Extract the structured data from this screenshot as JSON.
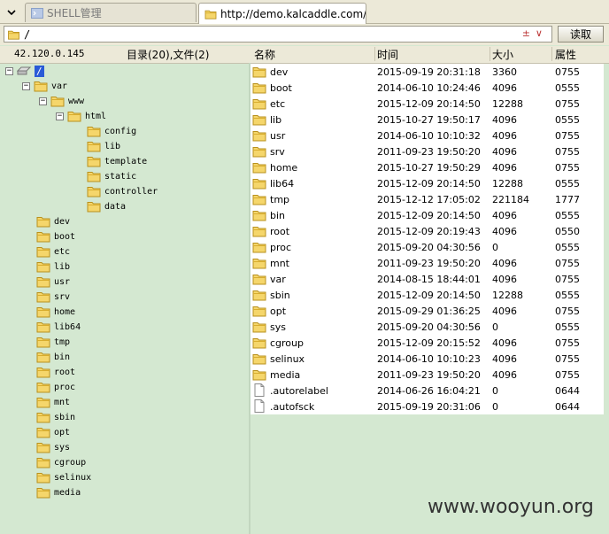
{
  "tabs": [
    {
      "label": "SHELL管理",
      "active": false
    },
    {
      "label": "http://demo.kalcaddle.com/conf...",
      "active": true
    }
  ],
  "address": {
    "value": "/",
    "read_label": "读取"
  },
  "header": {
    "ip": "42.120.0.145",
    "counts": "目录(20),文件(2)",
    "col_name": "名称",
    "col_time": "时间",
    "col_size": "大小",
    "col_attr": "属性"
  },
  "tree": {
    "root": "/",
    "var": "var",
    "www": "www",
    "html": "html",
    "html_children": [
      "config",
      "lib",
      "template",
      "static",
      "controller",
      "data"
    ],
    "top_dirs": [
      "dev",
      "boot",
      "etc",
      "lib",
      "usr",
      "srv",
      "home",
      "lib64",
      "tmp",
      "bin",
      "root",
      "proc",
      "mnt",
      "sbin",
      "opt",
      "sys",
      "cgroup",
      "selinux",
      "media"
    ]
  },
  "files": [
    {
      "name": "dev",
      "time": "2015-09-19 20:31:18",
      "size": "3360",
      "attr": "0755",
      "type": "folder"
    },
    {
      "name": "boot",
      "time": "2014-06-10 10:24:46",
      "size": "4096",
      "attr": "0555",
      "type": "folder"
    },
    {
      "name": "etc",
      "time": "2015-12-09 20:14:50",
      "size": "12288",
      "attr": "0755",
      "type": "folder"
    },
    {
      "name": "lib",
      "time": "2015-10-27 19:50:17",
      "size": "4096",
      "attr": "0555",
      "type": "folder"
    },
    {
      "name": "usr",
      "time": "2014-06-10 10:10:32",
      "size": "4096",
      "attr": "0755",
      "type": "folder"
    },
    {
      "name": "srv",
      "time": "2011-09-23 19:50:20",
      "size": "4096",
      "attr": "0755",
      "type": "folder"
    },
    {
      "name": "home",
      "time": "2015-10-27 19:50:29",
      "size": "4096",
      "attr": "0755",
      "type": "folder"
    },
    {
      "name": "lib64",
      "time": "2015-12-09 20:14:50",
      "size": "12288",
      "attr": "0555",
      "type": "folder"
    },
    {
      "name": "tmp",
      "time": "2015-12-12 17:05:02",
      "size": "221184",
      "attr": "1777",
      "type": "folder"
    },
    {
      "name": "bin",
      "time": "2015-12-09 20:14:50",
      "size": "4096",
      "attr": "0555",
      "type": "folder"
    },
    {
      "name": "root",
      "time": "2015-12-09 20:19:43",
      "size": "4096",
      "attr": "0550",
      "type": "folder"
    },
    {
      "name": "proc",
      "time": "2015-09-20 04:30:56",
      "size": "0",
      "attr": "0555",
      "type": "folder"
    },
    {
      "name": "mnt",
      "time": "2011-09-23 19:50:20",
      "size": "4096",
      "attr": "0755",
      "type": "folder"
    },
    {
      "name": "var",
      "time": "2014-08-15 18:44:01",
      "size": "4096",
      "attr": "0755",
      "type": "folder"
    },
    {
      "name": "sbin",
      "time": "2015-12-09 20:14:50",
      "size": "12288",
      "attr": "0555",
      "type": "folder"
    },
    {
      "name": "opt",
      "time": "2015-09-29 01:36:25",
      "size": "4096",
      "attr": "0755",
      "type": "folder"
    },
    {
      "name": "sys",
      "time": "2015-09-20 04:30:56",
      "size": "0",
      "attr": "0555",
      "type": "folder"
    },
    {
      "name": "cgroup",
      "time": "2015-12-09 20:15:52",
      "size": "4096",
      "attr": "0755",
      "type": "folder"
    },
    {
      "name": "selinux",
      "time": "2014-06-10 10:10:23",
      "size": "4096",
      "attr": "0755",
      "type": "folder"
    },
    {
      "name": "media",
      "time": "2011-09-23 19:50:20",
      "size": "4096",
      "attr": "0755",
      "type": "folder"
    },
    {
      "name": ".autorelabel",
      "time": "2014-06-26 16:04:21",
      "size": "0",
      "attr": "0644",
      "type": "file"
    },
    {
      "name": ".autofsck",
      "time": "2015-09-19 20:31:06",
      "size": "0",
      "attr": "0644",
      "type": "file"
    }
  ],
  "watermark": "www.wooyun.org",
  "colors": {
    "background": "#d4e8d1",
    "selection": "#2a5bd7",
    "folder": "#f5d66b"
  }
}
